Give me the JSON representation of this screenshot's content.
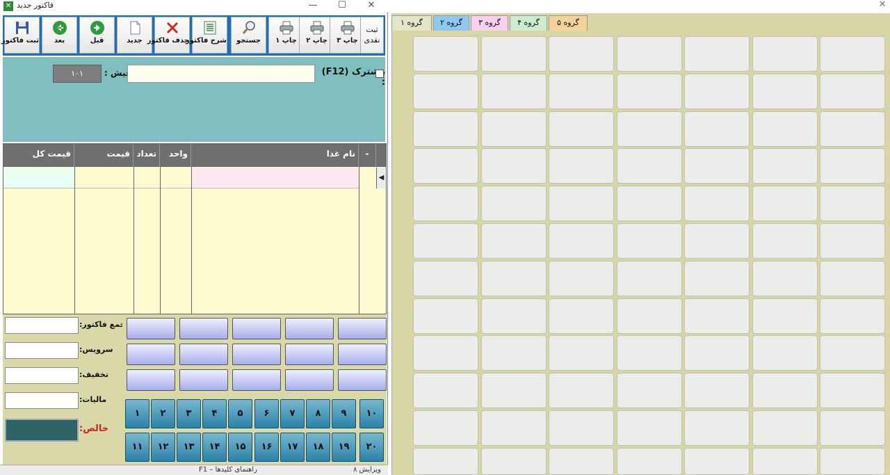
{
  "invoice_window": {
    "title": "فاکتور جدید",
    "controls": {
      "close": "✕",
      "maximize": "☐",
      "minimize": "—"
    }
  },
  "toolbar": {
    "buttons": [
      {
        "label": "ثبت فاکتور",
        "icon": "floppy-disk-icon"
      },
      {
        "label": "بعد",
        "icon": "arrow-left-icon"
      },
      {
        "label": "قبل",
        "icon": "arrow-right-icon"
      },
      {
        "label": "جدید",
        "icon": "new-document-icon"
      },
      {
        "label": "حذف فاکتور",
        "icon": "delete-x-icon"
      },
      {
        "label": "شرح فاکتور",
        "icon": "invoice-list-icon"
      },
      {
        "label": "جستجو",
        "icon": "magnifier-icon"
      },
      {
        "label": "چاپ ۱",
        "icon": "printer-icon"
      },
      {
        "label": "چاپ ۲",
        "icon": "printer-icon"
      },
      {
        "label": "چاپ ۳",
        "icon": "printer-icon"
      },
      {
        "label": "ثبت\nنقدی",
        "icon": ""
      }
    ]
  },
  "header_form": {
    "fish_label": "فیش :",
    "fish_value": "۱۰۱",
    "customer_label": "مشترک (F12) :",
    "customer_value": ""
  },
  "grid": {
    "columns": [
      "قیمت کل",
      "قیمت",
      "تعداد",
      "واحد",
      "نام غذا",
      "-"
    ],
    "row_indicator": "◀"
  },
  "totals": {
    "invoice_total_label": "جمع فاکتور:",
    "service_label": "سرویس:",
    "discount_label": "تخفیف:",
    "tax_label": "مالیات:",
    "net_label": "خالص:"
  },
  "number_buttons": [
    "۱",
    "۲",
    "۳",
    "۴",
    "۵",
    "۶",
    "۷",
    "۸",
    "۹",
    "۱۰",
    "۱۱",
    "۱۲",
    "۱۳",
    "۱۴",
    "۱۵",
    "۱۶",
    "۱۷",
    "۱۸",
    "۱۹",
    "۲۰"
  ],
  "status_bar": {
    "left_text": "راهنمای کلیدها – F1",
    "right_text": "ویرایش ۸"
  },
  "group_panel": {
    "close": "✕",
    "tabs": [
      {
        "label": "گروه ۱",
        "color": "#e4e4c6"
      },
      {
        "label": "گروه ۲",
        "color": "#8fc8f0"
      },
      {
        "label": "گروه ۳",
        "color": "#f6d0ec"
      },
      {
        "label": "گروه ۴",
        "color": "#cdeccd"
      },
      {
        "label": "گروه ۵",
        "color": "#f5d29a"
      }
    ]
  },
  "colors": {
    "toolbar_bg": "#1f6fb5",
    "form_bg": "#7fbfbf",
    "panel_bg": "#d6d6a6",
    "net_box": "#2f6262"
  }
}
